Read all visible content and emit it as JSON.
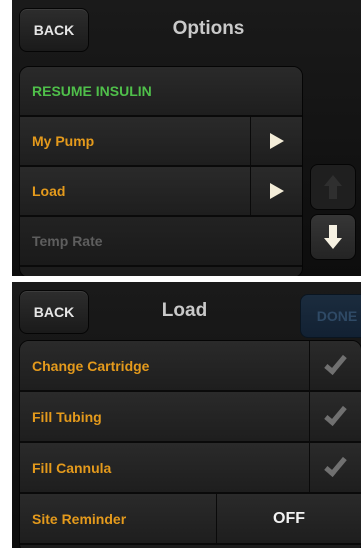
{
  "options_screen": {
    "title": "Options",
    "back_label": "BACK",
    "items": [
      {
        "label": "RESUME INSULIN"
      },
      {
        "label": "My Pump"
      },
      {
        "label": "Load"
      },
      {
        "label": "Temp Rate"
      }
    ]
  },
  "load_screen": {
    "title": "Load",
    "back_label": "BACK",
    "done_label": "DONE",
    "items": [
      {
        "label": "Change Cartridge"
      },
      {
        "label": "Fill Tubing"
      },
      {
        "label": "Fill Cannula"
      },
      {
        "label": "Site Reminder",
        "value": "OFF"
      }
    ]
  },
  "colors": {
    "item_text": "#e49a1c",
    "resume_text": "#4fbf4a",
    "disabled_text": "#5e5e5e"
  }
}
